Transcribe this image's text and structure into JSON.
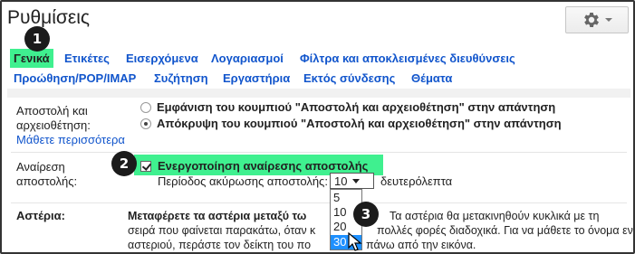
{
  "header": {
    "title": "Ρυθμίσεις"
  },
  "tabs": {
    "row1": [
      {
        "label": "Γενικά",
        "active": true
      },
      {
        "label": "Ετικέτες"
      },
      {
        "label": "Εισερχόμενα"
      },
      {
        "label": "Λογαριασμοί"
      },
      {
        "label": "Φίλτρα και αποκλεισμένες διευθύνσεις"
      }
    ],
    "row2": [
      {
        "label": "Προώθηση/POP/IMAP"
      },
      {
        "label": "Συζήτηση"
      },
      {
        "label": "Εργαστήρια"
      },
      {
        "label": "Εκτός σύνδεσης"
      },
      {
        "label": "Θέματα"
      }
    ]
  },
  "send_archive": {
    "label_line1": "Αποστολή και",
    "label_line2": "αρχειοθέτηση:",
    "learn_more": "Μάθετε περισσότερα",
    "options": [
      {
        "text": "Εμφάνιση του κουμπιού \"Αποστολή και αρχειοθέτηση\" στην απάντηση",
        "checked": false
      },
      {
        "text": "Απόκρυψη του κουμπιού \"Αποστολή και αρχειοθέτηση\" στην απάντηση",
        "checked": true
      }
    ]
  },
  "undo_send": {
    "label_line1": "Αναίρεση",
    "label_line2": "αποστολής:",
    "checkbox_label": "Ενεργοποίηση αναίρεσης αποστολής",
    "checked": true,
    "period_label": "Περίοδος ακύρωσης αποστολής:",
    "selected_value": "10",
    "period_unit": "δευτερόλεπτα",
    "options": [
      "5",
      "10",
      "20",
      "30"
    ],
    "highlighted_option": "30"
  },
  "stars": {
    "label": "Αστέρια:",
    "line1_bold": "Μεταφέρετε τα αστέρια μεταξύ τω",
    "line1_rest": "Τα αστέρια θα μετακινηθούν κυκλικά με τη",
    "line2a": "σειρά που φαίνεται παρακάτω, όταν κ",
    "line2b": "πολλές φορές διαδοχικά. Για να μάθετε το όνομα ενός",
    "line3a": "αστεριού, περάστε τον δείκτη του πο",
    "line3b": "πάνω από την εικόνα."
  },
  "badges": [
    "1",
    "2",
    "3"
  ],
  "colors": {
    "highlight": "#3ff08f",
    "link": "#1155cc",
    "selected_option": "#1e90ff"
  }
}
